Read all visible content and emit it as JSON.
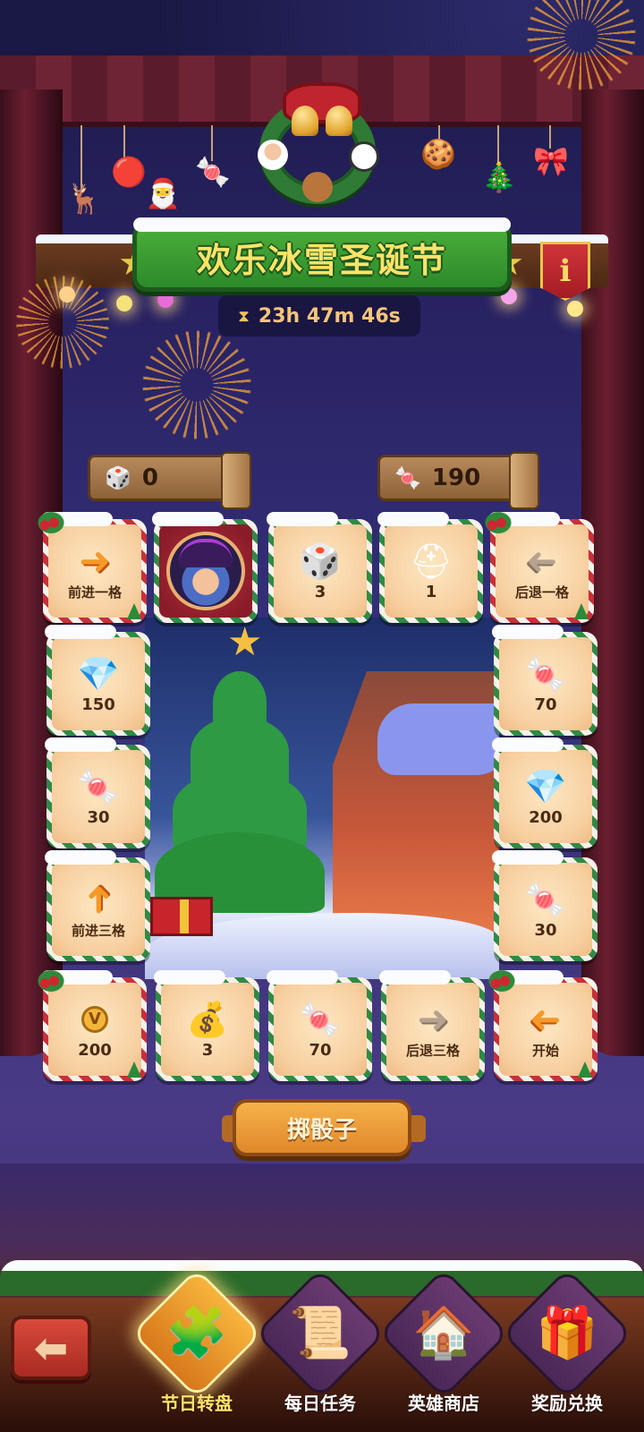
{
  "event": {
    "title": "欢乐冰雪圣诞节",
    "timer": "23h 47m 46s",
    "info_icon": "i"
  },
  "counters": {
    "dice": "0",
    "candy": "190"
  },
  "board": {
    "top_row": [
      {
        "label": "前进一格",
        "icon": "arrow-right"
      },
      {
        "label": "",
        "icon": "player-avatar"
      },
      {
        "label": "3",
        "icon": "dice"
      },
      {
        "label": "1",
        "icon": "golden-helmet"
      },
      {
        "label": "后退一格",
        "icon": "arrow-left"
      }
    ],
    "left_col": [
      {
        "label": "150",
        "icon": "diamond"
      },
      {
        "label": "30",
        "icon": "candy-cane"
      },
      {
        "label": "前进三格",
        "icon": "arrow-up"
      }
    ],
    "right_col": [
      {
        "label": "70",
        "icon": "candy-cane"
      },
      {
        "label": "200",
        "icon": "diamond"
      },
      {
        "label": "30",
        "icon": "candy-cane"
      }
    ],
    "bottom_row": [
      {
        "label": "200",
        "icon": "vip-coin"
      },
      {
        "label": "3",
        "icon": "loot-bag"
      },
      {
        "label": "70",
        "icon": "candy-cane"
      },
      {
        "label": "后退三格",
        "icon": "arrow-right"
      },
      {
        "label": "开始",
        "icon": "arrow-left"
      }
    ]
  },
  "roll_button": "掷骰子",
  "nav": {
    "items": [
      {
        "label": "节日转盘",
        "icon": "board-game",
        "active": true
      },
      {
        "label": "每日任务",
        "icon": "scroll-quest",
        "active": false
      },
      {
        "label": "英雄商店",
        "icon": "shop-house",
        "active": false
      },
      {
        "label": "奖励兑换",
        "icon": "gift-box",
        "active": false
      }
    ]
  },
  "colors": {
    "accent": "#f59a24",
    "title": "#ffe36a",
    "timer": "#f6c47c",
    "banner": "#2c8a2a"
  }
}
